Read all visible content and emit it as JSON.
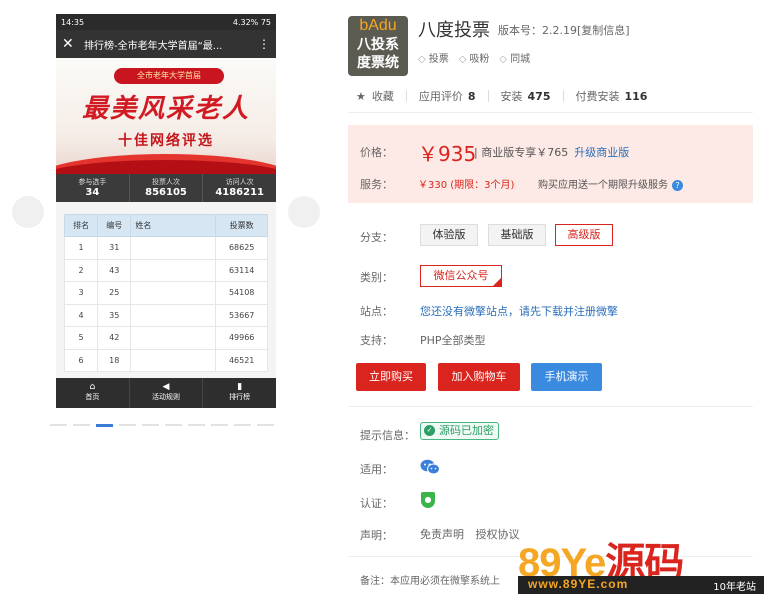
{
  "phone": {
    "status_time": "14:35",
    "status_right": "4.32% 75",
    "title": "排行榜-全市老年大学首届“最...",
    "banner_pill": "全市老年大学首届",
    "banner_big": "最美风采老人",
    "banner_sub": "十佳网络评选",
    "stats": [
      {
        "label": "参与选手",
        "value": "34"
      },
      {
        "label": "投票人次",
        "value": "856105"
      },
      {
        "label": "访问人次",
        "value": "4186211"
      }
    ],
    "table_headers": [
      "排名",
      "编号",
      "姓名",
      "投票数"
    ],
    "rows": [
      {
        "rank": "1",
        "num": "31",
        "name": "",
        "votes": "68625"
      },
      {
        "rank": "2",
        "num": "43",
        "name": "",
        "votes": "63114"
      },
      {
        "rank": "3",
        "num": "25",
        "name": "",
        "votes": "54108"
      },
      {
        "rank": "4",
        "num": "35",
        "name": "",
        "votes": "53667"
      },
      {
        "rank": "5",
        "num": "42",
        "name": "",
        "votes": "49966"
      },
      {
        "rank": "6",
        "num": "18",
        "name": "",
        "votes": "46521"
      }
    ],
    "tabs": [
      {
        "icon": "home-icon",
        "glyph": "⌂",
        "label": "首页"
      },
      {
        "icon": "megaphone-icon",
        "glyph": "◀",
        "label": "活动规则"
      },
      {
        "icon": "bar-chart-icon",
        "glyph": "▮",
        "label": "排行榜"
      }
    ]
  },
  "app": {
    "logo_top": "bAdu",
    "logo_line1": "八投系",
    "logo_line2": "度票统",
    "name": "八度投票",
    "version": "版本号：2.2.19[复制信息]",
    "tags": [
      "投票",
      "吸粉",
      "同城"
    ]
  },
  "metrics": {
    "collect": "收藏",
    "rating_label": "应用评价",
    "rating": "8",
    "install_label": "安装",
    "install": "475",
    "paid_label": "付费安装",
    "paid": "116"
  },
  "pricing": {
    "price_label": "价格：",
    "price": "￥935",
    "note": "| 商业版专享￥765",
    "upgrade": "升级商业版",
    "service_label": "服务：",
    "service": "￥330 (期限：3个月)",
    "service_note": "购买应用送一个期限升级服务"
  },
  "branch": {
    "label": "分支：",
    "options": [
      "体验版",
      "基础版",
      "高级版"
    ]
  },
  "category": {
    "label": "类别：",
    "value": "微信公众号"
  },
  "site": {
    "label": "站点：",
    "value": "您还没有微擎站点，请先下载并注册微擎"
  },
  "support": {
    "label": "支持：",
    "value": "PHP全部类型"
  },
  "buttons": {
    "buy": "立即购买",
    "cart": "加入购物车",
    "demo": "手机演示"
  },
  "tips": {
    "label": "提示信息：",
    "badge": "源码已加密"
  },
  "fit": {
    "label": "适用："
  },
  "cert": {
    "label": "认证："
  },
  "declare": {
    "label": "声明：",
    "items": [
      "免责声明",
      "授权协议"
    ]
  },
  "remark": "备注：本应用必须在微擎系统上",
  "watermark": {
    "brand_num": "89",
    "brand_ye": "Ye",
    "brand_cn": "源码",
    "url": "www.89YE.com",
    "years": "10年老站"
  },
  "colors": {
    "accent_red": "#d9251d",
    "link_blue": "#2a6ebb",
    "price_bg": "#fde9e5"
  }
}
